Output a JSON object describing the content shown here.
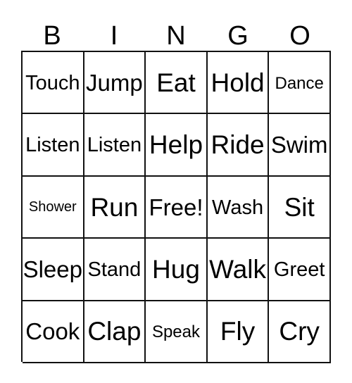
{
  "card": {
    "type": "bingo-card",
    "title": "BINGO",
    "columns": 5,
    "rows": 5,
    "free_space_label": "Free!",
    "free_space_position": {
      "row": 3,
      "column": 3
    },
    "colors": {
      "background": "#ffffff",
      "border": "#111111",
      "text": "#000000"
    }
  },
  "header": {
    "letters": [
      "B",
      "I",
      "N",
      "G",
      "O"
    ]
  },
  "grid": {
    "rows": [
      {
        "cells": [
          {
            "label": "Touch",
            "size": "md"
          },
          {
            "label": "Jump",
            "size": "lg"
          },
          {
            "label": "Eat",
            "size": "xl"
          },
          {
            "label": "Hold",
            "size": "xl"
          },
          {
            "label": "Dance",
            "size": "sm"
          }
        ]
      },
      {
        "cells": [
          {
            "label": "Listen",
            "size": "md"
          },
          {
            "label": "Listen",
            "size": "md"
          },
          {
            "label": "Help",
            "size": "xl"
          },
          {
            "label": "Ride",
            "size": "xl"
          },
          {
            "label": "Swim",
            "size": "lg"
          }
        ]
      },
      {
        "cells": [
          {
            "label": "Shower",
            "size": "xs"
          },
          {
            "label": "Run",
            "size": "xl"
          },
          {
            "label": "Free!",
            "size": "lg"
          },
          {
            "label": "Wash",
            "size": "md"
          },
          {
            "label": "Sit",
            "size": "xl"
          }
        ]
      },
      {
        "cells": [
          {
            "label": "Sleep",
            "size": "lg"
          },
          {
            "label": "Stand",
            "size": "md"
          },
          {
            "label": "Hug",
            "size": "xl"
          },
          {
            "label": "Walk",
            "size": "xl"
          },
          {
            "label": "Greet",
            "size": "md"
          }
        ]
      },
      {
        "cells": [
          {
            "label": "Cook",
            "size": "lg"
          },
          {
            "label": "Clap",
            "size": "xl"
          },
          {
            "label": "Speak",
            "size": "sm"
          },
          {
            "label": "Fly",
            "size": "xl"
          },
          {
            "label": "Cry",
            "size": "xl"
          }
        ]
      }
    ]
  }
}
